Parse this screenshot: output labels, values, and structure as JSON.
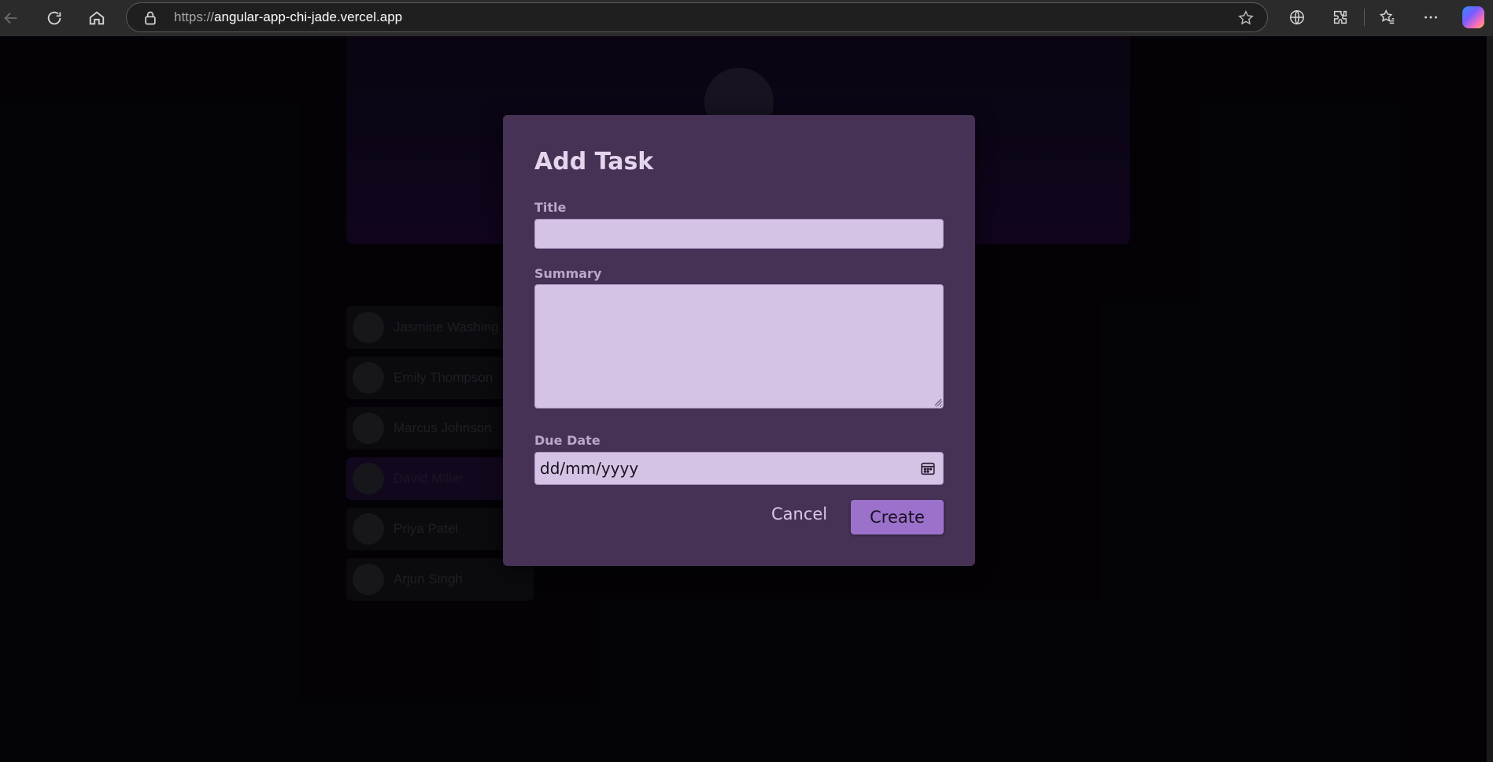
{
  "browser": {
    "url_protocol": "https://",
    "url_host": "angular-app-chi-jade.vercel.app",
    "icons": [
      "back-icon",
      "refresh-icon",
      "home-icon",
      "lock-icon",
      "star-icon",
      "globe-icon",
      "extensions-icon",
      "favorites-icon",
      "more-icon",
      "copilot-icon"
    ]
  },
  "background": {
    "users": [
      {
        "name": "Jasmine Washing",
        "selected": false
      },
      {
        "name": "Emily Thompson",
        "selected": false
      },
      {
        "name": "Marcus Johnson",
        "selected": false
      },
      {
        "name": "David Miller",
        "selected": true
      },
      {
        "name": "Priya Patel",
        "selected": false
      },
      {
        "name": "Arjun Singh",
        "selected": false
      }
    ]
  },
  "modal": {
    "title": "Add Task",
    "title_label": "Title",
    "title_value": "",
    "summary_label": "Summary",
    "summary_value": "",
    "due_date_label": "Due Date",
    "due_date_placeholder": "dd/mm/yyyy",
    "cancel_label": "Cancel",
    "create_label": "Create"
  },
  "colors": {
    "modal_bg": "#453254",
    "input_bg": "#d4c3e5",
    "create_button": "#9b71cc",
    "page_bg": "#000000"
  }
}
